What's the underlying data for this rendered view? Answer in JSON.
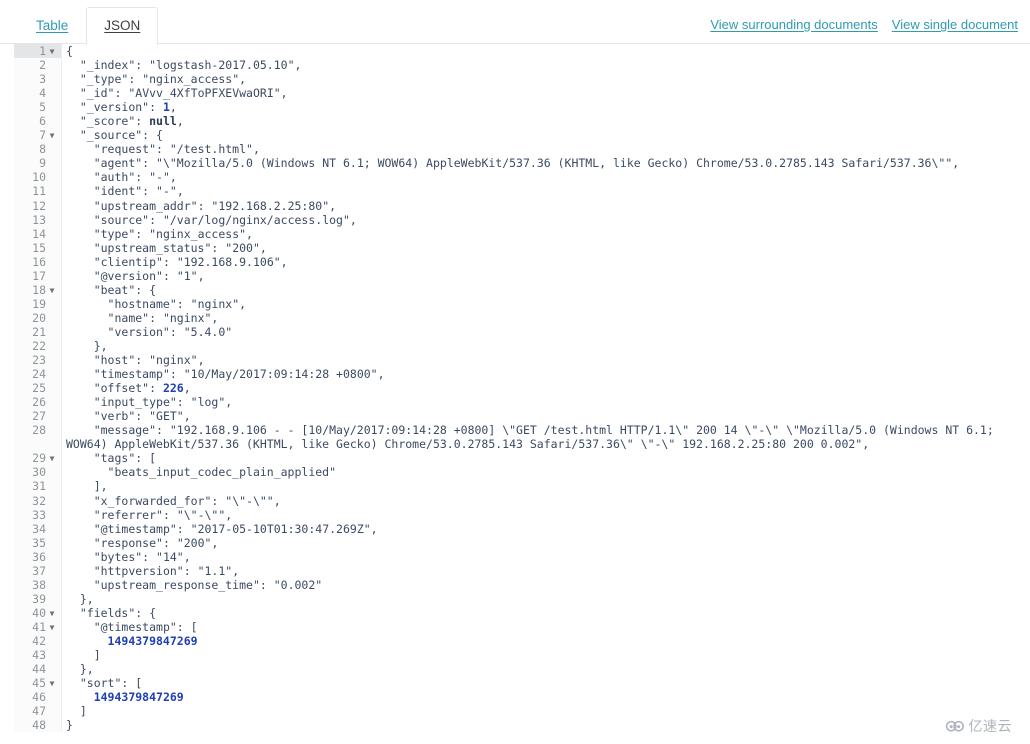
{
  "tabs": [
    {
      "label": "Table",
      "active": false,
      "name": "tab-table"
    },
    {
      "label": "JSON",
      "active": true,
      "name": "tab-json"
    }
  ],
  "header_links": [
    {
      "label": "View surrounding documents",
      "name": "view-surrounding-documents-link"
    },
    {
      "label": "View single document",
      "name": "view-single-document-link"
    }
  ],
  "colors": {
    "link": "#2f9bb1",
    "key": "#3b4a63",
    "number": "#1f3fb5",
    "gutter_bg": "#fbfbfb",
    "active_line": "#e3e5e7"
  },
  "editor": {
    "active_line": 1,
    "total_lines": 48,
    "foldable_lines": [
      1,
      7,
      18,
      29,
      40,
      41,
      45
    ],
    "lines": [
      {
        "n": 1,
        "text": "{"
      },
      {
        "n": 2,
        "text": "  \"_index\": \"logstash-2017.05.10\","
      },
      {
        "n": 3,
        "text": "  \"_type\": \"nginx_access\","
      },
      {
        "n": 4,
        "text": "  \"_id\": \"AVvv_4XfToPFXEVwaORI\","
      },
      {
        "n": 5,
        "text": "  \"_version\": 1,"
      },
      {
        "n": 6,
        "text": "  \"_score\": null,"
      },
      {
        "n": 7,
        "text": "  \"_source\": {"
      },
      {
        "n": 8,
        "text": "    \"request\": \"/test.html\","
      },
      {
        "n": 9,
        "text": "    \"agent\": \"\\\"Mozilla/5.0 (Windows NT 6.1; WOW64) AppleWebKit/537.36 (KHTML, like Gecko) Chrome/53.0.2785.143 Safari/537.36\\\"\","
      },
      {
        "n": 10,
        "text": "    \"auth\": \"-\","
      },
      {
        "n": 11,
        "text": "    \"ident\": \"-\","
      },
      {
        "n": 12,
        "text": "    \"upstream_addr\": \"192.168.2.25:80\","
      },
      {
        "n": 13,
        "text": "    \"source\": \"/var/log/nginx/access.log\","
      },
      {
        "n": 14,
        "text": "    \"type\": \"nginx_access\","
      },
      {
        "n": 15,
        "text": "    \"upstream_status\": \"200\","
      },
      {
        "n": 16,
        "text": "    \"clientip\": \"192.168.9.106\","
      },
      {
        "n": 17,
        "text": "    \"@version\": \"1\","
      },
      {
        "n": 18,
        "text": "    \"beat\": {"
      },
      {
        "n": 19,
        "text": "      \"hostname\": \"nginx\","
      },
      {
        "n": 20,
        "text": "      \"name\": \"nginx\","
      },
      {
        "n": 21,
        "text": "      \"version\": \"5.4.0\""
      },
      {
        "n": 22,
        "text": "    },"
      },
      {
        "n": 23,
        "text": "    \"host\": \"nginx\","
      },
      {
        "n": 24,
        "text": "    \"timestamp\": \"10/May/2017:09:14:28 +0800\","
      },
      {
        "n": 25,
        "text": "    \"offset\": 226,"
      },
      {
        "n": 26,
        "text": "    \"input_type\": \"log\","
      },
      {
        "n": 27,
        "text": "    \"verb\": \"GET\","
      },
      {
        "n": 28,
        "text": "    \"message\": \"192.168.9.106 - - [10/May/2017:09:14:28 +0800] \\\"GET /test.html HTTP/1.1\\\" 200 14 \\\"-\\\" \\\"Mozilla/5.0 (Windows NT 6.1; WOW64) AppleWebKit/537.36 (KHTML, like Gecko) Chrome/53.0.2785.143 Safari/537.36\\\" \\\"-\\\" 192.168.2.25:80 200 0.002\","
      },
      {
        "n": 29,
        "text": "    \"tags\": ["
      },
      {
        "n": 30,
        "text": "      \"beats_input_codec_plain_applied\""
      },
      {
        "n": 31,
        "text": "    ],"
      },
      {
        "n": 32,
        "text": "    \"x_forwarded_for\": \"\\\"-\\\"\","
      },
      {
        "n": 33,
        "text": "    \"referrer\": \"\\\"-\\\"\","
      },
      {
        "n": 34,
        "text": "    \"@timestamp\": \"2017-05-10T01:30:47.269Z\","
      },
      {
        "n": 35,
        "text": "    \"response\": \"200\","
      },
      {
        "n": 36,
        "text": "    \"bytes\": \"14\","
      },
      {
        "n": 37,
        "text": "    \"httpversion\": \"1.1\","
      },
      {
        "n": 38,
        "text": "    \"upstream_response_time\": \"0.002\""
      },
      {
        "n": 39,
        "text": "  },"
      },
      {
        "n": 40,
        "text": "  \"fields\": {"
      },
      {
        "n": 41,
        "text": "    \"@timestamp\": ["
      },
      {
        "n": 42,
        "text": "      1494379847269"
      },
      {
        "n": 43,
        "text": "    ]"
      },
      {
        "n": 44,
        "text": "  },"
      },
      {
        "n": 45,
        "text": "  \"sort\": ["
      },
      {
        "n": 46,
        "text": "    1494379847269"
      },
      {
        "n": 47,
        "text": "  ]"
      },
      {
        "n": 48,
        "text": "}"
      }
    ]
  },
  "watermark": {
    "text": "亿速云",
    "icon": "cloud-logo-icon"
  }
}
